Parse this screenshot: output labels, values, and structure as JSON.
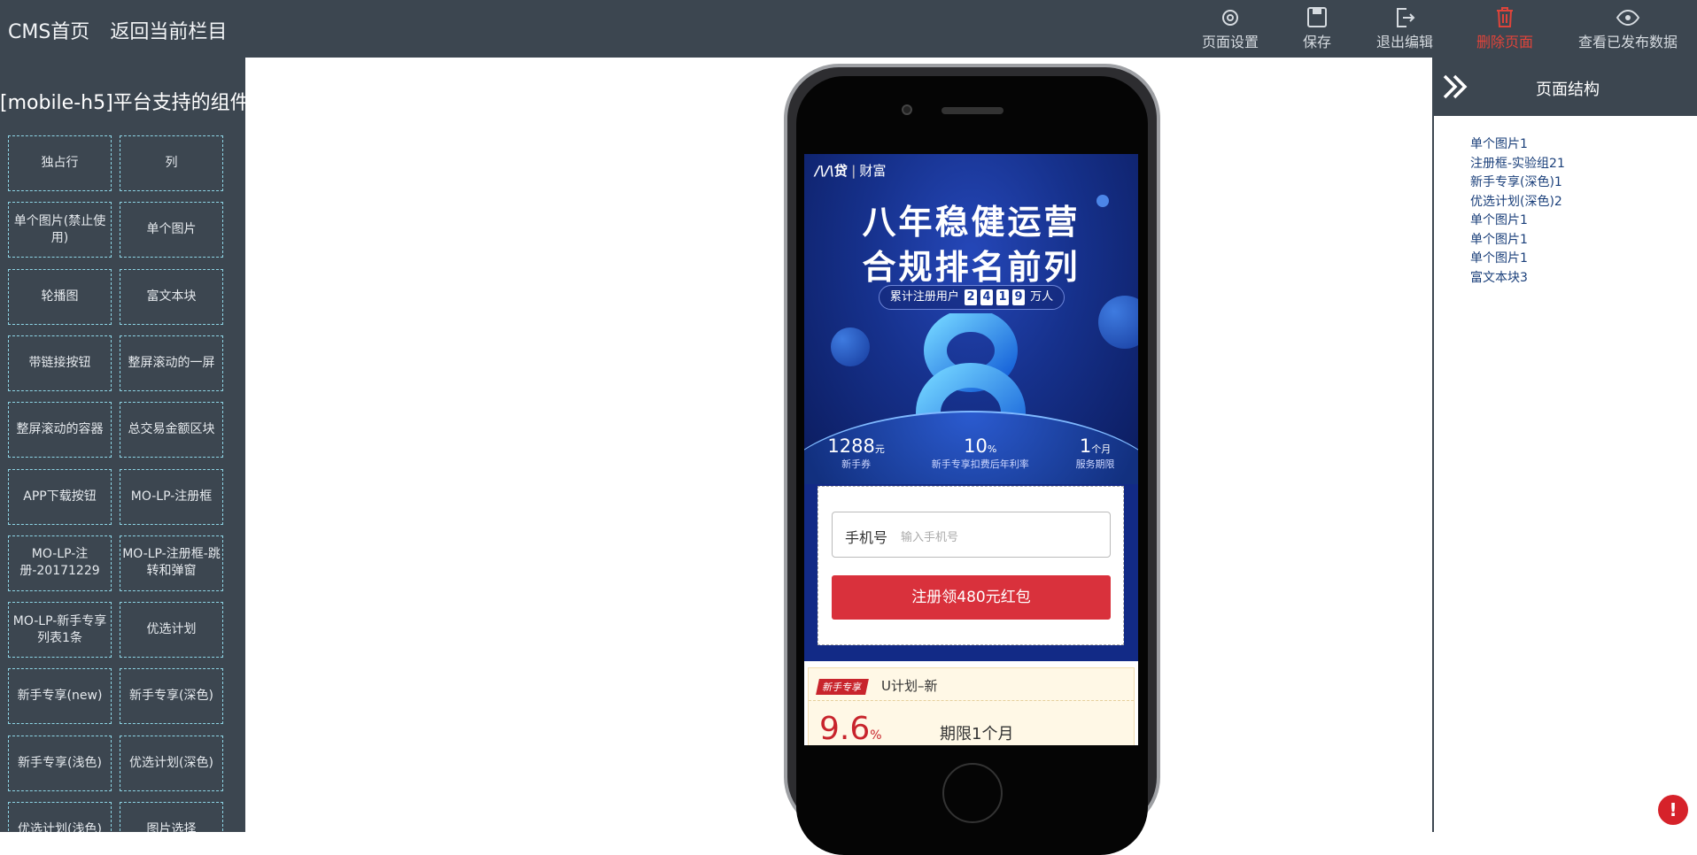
{
  "header": {
    "nav": [
      "CMS首页",
      "返回当前栏目"
    ],
    "tools": {
      "settings": "页面设置",
      "save": "保存",
      "exit": "退出编辑",
      "delete": "删除页面",
      "view": "查看已发布数据"
    }
  },
  "sidebar": {
    "title": "[mobile-h5]平台支持的组件",
    "components": [
      "独占行",
      "列",
      "单个图片(禁止使用)",
      "单个图片",
      "轮播图",
      "富文本块",
      "带链接按钮",
      "整屏滚动的一屏",
      "整屏滚动的容器",
      "总交易金额区块",
      "APP下载按钮",
      "MO-LP-注册框",
      "MO-LP-注册-20171229",
      "MO-LP-注册框-跳转和弹窗",
      "MO-LP-新手专享列表1条",
      "优选计划",
      "新手专享(new)",
      "新手专享(深色)",
      "新手专享(浅色)",
      "优选计划(深色)",
      "优选计划(浅色)",
      "图片选择"
    ]
  },
  "structure": {
    "title": "页面结构",
    "items": [
      "单个图片1",
      "注册框-实验组21",
      "新手专享(深色)1",
      "优选计划(深色)2",
      "单个图片1",
      "单个图片1",
      "单个图片1",
      "富文本块3"
    ]
  },
  "preview": {
    "brand_logo": "贷",
    "brand_label": "财富",
    "headline1": "八年稳健运营",
    "headline2": "合规排名前列",
    "users_prefix": "累计注册用户",
    "users_digits": [
      "2",
      "4",
      "1",
      "9"
    ],
    "users_suffix": "万人",
    "stats": [
      {
        "value": "1288",
        "unit": "元",
        "label": "新手券"
      },
      {
        "value": "10",
        "unit": "%",
        "label": "新手专享扣费后年利率"
      },
      {
        "value": "1",
        "unit": "个月",
        "label": "服务期限"
      }
    ],
    "register": {
      "phone_label": "手机号",
      "phone_placeholder": "输入手机号",
      "button": "注册领480元红包"
    },
    "product": {
      "tag": "新手专享",
      "name": "U计划–新",
      "rate": "9.6",
      "rate_unit": "%",
      "term": "期限1个月"
    }
  },
  "alert": "!"
}
